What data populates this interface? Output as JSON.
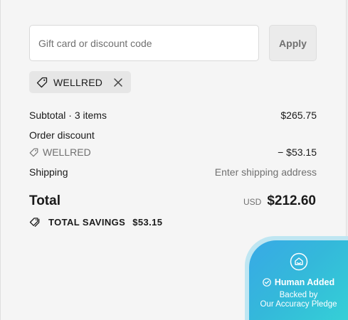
{
  "discount": {
    "input_placeholder": "Gift card or discount code",
    "input_value": "",
    "apply_label": "Apply"
  },
  "applied_code": {
    "icon": "tag-icon",
    "label": "WELLRED",
    "remove_icon": "close-icon"
  },
  "summary": {
    "subtotal_label": "Subtotal · 3 items",
    "subtotal_value": "$265.75",
    "order_discount_label": "Order discount",
    "discount_code": "WELLRED",
    "discount_value": "− $53.15",
    "shipping_label": "Shipping",
    "shipping_value": "Enter shipping address"
  },
  "total": {
    "label": "Total",
    "currency": "USD",
    "amount": "$212.60"
  },
  "savings": {
    "icon": "tags-icon",
    "label": "TOTAL SAVINGS",
    "amount": "$53.15"
  },
  "badge": {
    "logo_icon": "house-shield-icon",
    "check_icon": "check-circle-icon",
    "title": "Human Added",
    "line1": "Backed by",
    "line2": "Our Accuracy Pledge"
  },
  "colors": {
    "panel_bg": "#f5f5f5",
    "muted_text": "#707070",
    "badge_gradient_start": "#38a9e6",
    "badge_gradient_end": "#35d4d6"
  }
}
